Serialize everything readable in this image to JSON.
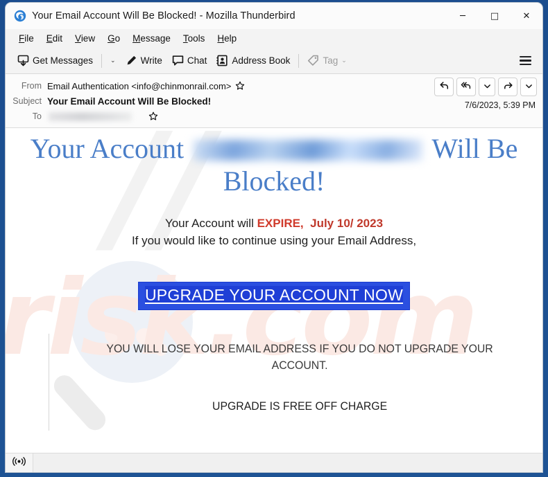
{
  "window": {
    "title": "Your Email Account Will Be Blocked! - Mozilla Thunderbird",
    "app_icon": "thunderbird-icon",
    "controls": {
      "minimize": "─",
      "maximize": "□",
      "close": "✕"
    }
  },
  "menubar": {
    "items": [
      {
        "label": "File",
        "accesskey": "F"
      },
      {
        "label": "Edit",
        "accesskey": "E"
      },
      {
        "label": "View",
        "accesskey": "V"
      },
      {
        "label": "Go",
        "accesskey": "G"
      },
      {
        "label": "Message",
        "accesskey": "M"
      },
      {
        "label": "Tools",
        "accesskey": "T"
      },
      {
        "label": "Help",
        "accesskey": "H"
      }
    ]
  },
  "toolbar": {
    "get_messages": "Get Messages",
    "get_messages_icon": "get-messages-icon",
    "get_messages_caret": "⌄",
    "write": "Write",
    "write_icon": "pencil-icon",
    "chat": "Chat",
    "chat_icon": "chat-bubble-icon",
    "address_book": "Address Book",
    "address_book_icon": "address-book-icon",
    "tag": "Tag",
    "tag_icon": "tag-icon",
    "tag_caret": "⌄",
    "tag_disabled": "true",
    "app_menu_icon": "hamburger-menu-icon"
  },
  "message_header": {
    "from_label": "From",
    "from_value": "Email Authentication <info@chinmonrail.com>",
    "from_star_icon": "star-outline-icon",
    "subject_label": "Subject",
    "subject_value": "Your Email Account Will Be Blocked!",
    "to_label": "To",
    "to_value_redacted": "",
    "to_star_icon": "star-outline-icon",
    "date": "7/6/2023, 5:39 PM",
    "actions": [
      {
        "name": "reply-button",
        "icon": "reply-arrow-icon"
      },
      {
        "name": "reply-all-button",
        "icon": "reply-all-arrow-icon"
      },
      {
        "name": "reply-more-dropdown",
        "icon": "chevron-down-icon"
      },
      {
        "name": "forward-button",
        "icon": "forward-arrow-icon"
      },
      {
        "name": "more-actions-dropdown",
        "icon": "chevron-down-icon"
      }
    ]
  },
  "email_body": {
    "heading_part1": "Your Account",
    "heading_redacted_email": "",
    "heading_part2": "Will Be",
    "heading_part3": "Blocked!",
    "expire_line_prefix": "Your Account will ",
    "expire_word": "EXPIRE,",
    "expire_date": "July 10/ 2023",
    "continue_line": "If you would like to continue using your Email Address,",
    "cta_label": "UPGRADE YOUR ACCOUNT NOW",
    "warning_line": "YOU WILL LOSE YOUR EMAIL ADDRESS IF YOU DO NOT UPGRADE YOUR ACCOUNT.",
    "free_line": "UPGRADE IS FREE OFF CHARGE",
    "watermark_text": "risk.com",
    "watermark_icon": "magnifier-watermark-icon"
  },
  "statusbar": {
    "feed_icon": "rss-broadcast-icon",
    "text": ""
  },
  "colors": {
    "heading_blue": "#4a7ec8",
    "expire_red": "#d03a2b",
    "cta_blue": "#2b4fe0",
    "window_frame": "#1d4f91",
    "watermark_pink": "#fbe9e4"
  }
}
